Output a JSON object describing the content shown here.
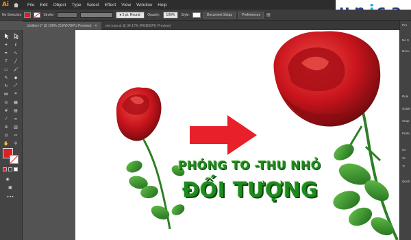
{
  "brand": {
    "name": "unica",
    "colors": {
      "dark": "#2b3a8c",
      "light": "#2aa6d6"
    }
  },
  "menubar": {
    "app_logo": "Ai",
    "items": [
      "File",
      "Edit",
      "Object",
      "Type",
      "Select",
      "Effect",
      "View",
      "Window",
      "Help"
    ]
  },
  "control_bar": {
    "selection": "No Selection",
    "stroke_label": "Stroke:",
    "brush": "5 pt. Round",
    "opacity_label": "Opacity:",
    "opacity_value": "100%",
    "style_label": "Style:",
    "document_setup": "Document Setup",
    "preferences": "Preferences"
  },
  "tabs": [
    {
      "label": "Untitled-1* @ 100% (CMYK/GPU Preview)",
      "active": true
    },
    {
      "label": "red rose.ai @ 34.17% (RGB/GPU Preview)",
      "active": false
    }
  ],
  "right_panel": {
    "items": [
      "Pro",
      "No S",
      "Docu",
      "Rule",
      "Guide",
      "Snap",
      "Prefe",
      "Un",
      "Sc",
      "Tr",
      "Quick"
    ]
  },
  "artwork": {
    "headline_line1": "PHÓNG TO -THU NHỎ",
    "headline_line2": "ĐỐI TƯỢNG",
    "colors": {
      "arrow": "#e8202a",
      "rose": "#c8141c",
      "leaf": "#2f8f2a",
      "text": "#1f8a1f"
    }
  },
  "tools": {
    "fill_color": "#e01e25"
  }
}
